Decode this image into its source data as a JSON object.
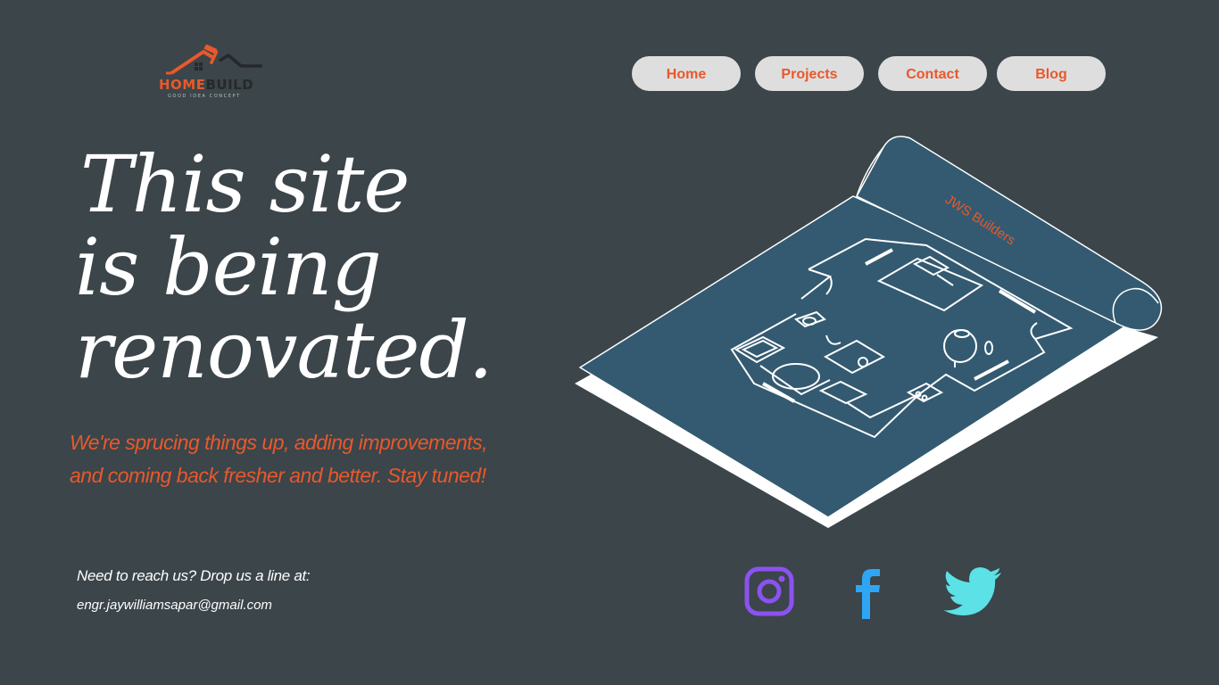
{
  "logo": {
    "word_part1": "HOME",
    "word_part2": "BUILD",
    "tagline": "GOOD IDEA CONCEPT",
    "icon": "house-roof-hammer-icon",
    "colors": {
      "accent": "#e9582b",
      "dark": "#26292b"
    }
  },
  "nav": {
    "items": [
      {
        "label": "Home"
      },
      {
        "label": "Projects"
      },
      {
        "label": "Contact"
      },
      {
        "label": "Blog"
      }
    ]
  },
  "hero": {
    "line1": "This site",
    "line2": "is being",
    "line3": "renovated.",
    "sub_line1": "We're sprucing things up, adding improvements,",
    "sub_line2": "and coming back fresher and better. Stay tuned!"
  },
  "contact": {
    "prompt": "Need to reach us? Drop us a line at:",
    "email": "engr.jaywilliamsapar@gmail.com"
  },
  "blueprint": {
    "label": "JWS Builders",
    "colors": {
      "paper": "#335a70",
      "lines": "#ffffff",
      "label": "#e9582b"
    }
  },
  "social": {
    "instagram": {
      "icon": "instagram-icon",
      "color": "#8b52f0"
    },
    "facebook": {
      "icon": "facebook-icon",
      "color": "#2ea6f5"
    },
    "twitter": {
      "icon": "twitter-icon",
      "color": "#5ce1e6"
    }
  },
  "colors": {
    "background": "#3b454a",
    "accent": "#e9582b",
    "nav_bg": "#dedede"
  }
}
